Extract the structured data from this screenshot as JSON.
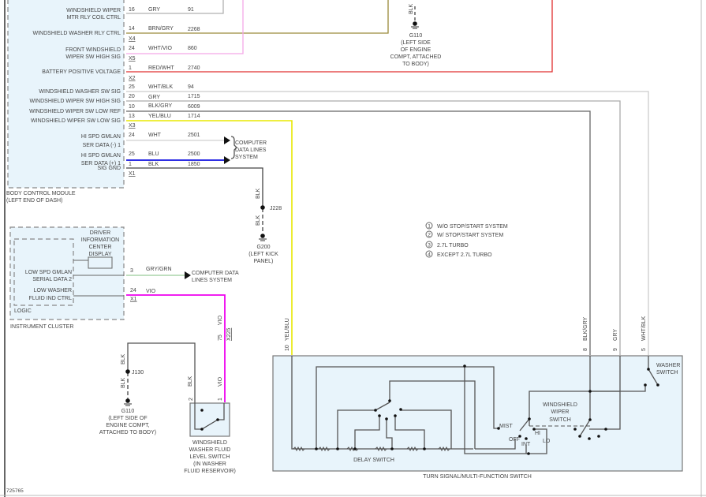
{
  "diagram_id": "725765",
  "colors": {
    "gry": "#b0b0b0",
    "brn_gry": "#9a8a3a",
    "wht_vio": "#f4a8e8",
    "red_wht": "#e03030",
    "wht_blk": "#cccccc",
    "blk_gry": "#666666",
    "yel_blu": "#f0f000",
    "wht": "#d8d8d8",
    "blu": "#1010e0",
    "blk": "#444444",
    "gry_grn": "#99cc99",
    "vio": "#ee00ee",
    "module_fill": "#e8f4fb"
  },
  "bcm": {
    "title": "BODY CONTROL MODULE",
    "location": "(LEFT END OF DASH)",
    "pins": [
      {
        "label1": "WINDSHIELD WIPER",
        "label2": "MTR RLY COIL CTRL",
        "pin": "16",
        "color": "GRY",
        "circuit": "91",
        "connector": ""
      },
      {
        "label1": "WINDSHIELD WASHER RLY CTRL",
        "label2": "",
        "pin": "14",
        "color": "BRN/GRY",
        "circuit": "2268",
        "connector": "X4"
      },
      {
        "label1": "FRONT WINDSHIELD",
        "label2": "WIPER SW HIGH SIG",
        "pin": "24",
        "color": "WHT/VIO",
        "circuit": "860",
        "connector": "X5"
      },
      {
        "label1": "BATTERY POSITIVE VOLTAGE",
        "label2": "",
        "pin": "1",
        "color": "RED/WHT",
        "circuit": "2740",
        "connector": "X2"
      },
      {
        "label1": "WINDSHIELD WASHER SW SIG",
        "label2": "",
        "pin": "25",
        "color": "WHT/BLK",
        "circuit": "94",
        "connector": ""
      },
      {
        "label1": "WINDSHIELD WIPER SW HIGH SIG",
        "label2": "",
        "pin": "20",
        "color": "GRY",
        "circuit": "1715",
        "connector": ""
      },
      {
        "label1": "WINDSHIELD WIPER SW LOW REF",
        "label2": "",
        "pin": "10",
        "color": "BLK/GRY",
        "circuit": "6009",
        "connector": ""
      },
      {
        "label1": "WINDSHIELD WIPER SW LOW SIG",
        "label2": "",
        "pin": "13",
        "color": "YEL/BLU",
        "circuit": "1714",
        "connector": "X3"
      },
      {
        "label1": "HI SPD GMLAN",
        "label2": "SER DATA (-) 1",
        "pin": "24",
        "color": "WHT",
        "circuit": "2501",
        "connector": ""
      },
      {
        "label1": "HI SPD GMLAN",
        "label2": "SER DATA (+) 1",
        "pin": "25",
        "color": "BLU",
        "circuit": "2500",
        "connector": ""
      },
      {
        "label1": "SIG GND",
        "label2": "",
        "pin": "1",
        "color": "BLK",
        "circuit": "1850",
        "connector": "X1"
      }
    ]
  },
  "computer_data_lines_1": [
    "COMPUTER",
    "DATA LINES",
    "SYSTEM"
  ],
  "g110_top": {
    "wire": "BLK",
    "name": "G110",
    "desc": [
      "(LEFT SIDE",
      "OF ENGINE",
      "COMPT, ATTACHED",
      "TO BODY)"
    ]
  },
  "g200": {
    "wire1": "BLK",
    "wire2": "BLK",
    "splice": "J228",
    "name": "G200",
    "desc": [
      "(LEFT KICK",
      "PANEL)"
    ]
  },
  "legend": [
    {
      "num": "1",
      "text": "W/O STOP/START SYSTEM"
    },
    {
      "num": "2",
      "text": "W/ STOP/START SYSTEM"
    },
    {
      "num": "3",
      "text": "2.7L TURBO"
    },
    {
      "num": "4",
      "text": "EXCEPT 2.7L TURBO"
    }
  ],
  "cluster": {
    "title": "INSTRUMENT CLUSTER",
    "logic": "LOGIC",
    "dic": [
      "DRIVER",
      "INFORMATION",
      "CENTER",
      "DISPLAY"
    ],
    "pin_a": {
      "label1": "LOW SPD GMLAN",
      "label2": "SERIAL DATA 2",
      "pin": "3",
      "color": "GRY/GRN"
    },
    "pin_b": {
      "label1": "LOW WASHER",
      "label2": "FLUID IND CTRL",
      "pin": "24",
      "color": "VIO",
      "connector": "X1"
    },
    "data_lines": [
      "COMPUTER DATA",
      "LINES SYSTEM"
    ]
  },
  "vio_inline": {
    "color": "VIO",
    "pin": "75",
    "connector": "X225"
  },
  "g110_bottom": {
    "wire1": "BLK",
    "wire2": "BLK",
    "splice": "J130",
    "name": "G110",
    "desc": [
      "(LEFT SIDE OF",
      "ENGINE COMPT,",
      "ATTACHED TO BODY)"
    ]
  },
  "fluid_switch": {
    "pin2": "2",
    "wire2": "BLK",
    "pin1": "1",
    "wire1": "VIO",
    "name": [
      "WINDSHIELD",
      "WASHER FLUID",
      "LEVEL SWITCH",
      "(IN WASHER",
      "FLUID RESERVOIR)"
    ]
  },
  "mfs": {
    "title": "TURN SIGNAL/MULTI-FUNCTION SWITCH",
    "pins": [
      {
        "pin": "10",
        "color": "YEL/BLU"
      },
      {
        "pin": "8",
        "color": "BLK/GRY"
      },
      {
        "pin": "9",
        "color": "GRY"
      },
      {
        "pin": "5",
        "color": "WHT/BLK"
      }
    ],
    "delay": "DELAY SWITCH",
    "wiper": [
      "WINDSHIELD",
      "WIPER",
      "SWITCH"
    ],
    "washer": [
      "WASHER",
      "SWITCH"
    ],
    "positions": {
      "mist": "MIST",
      "off": "OFF",
      "int": "INT",
      "hi": "HI",
      "lo": "LO"
    }
  }
}
